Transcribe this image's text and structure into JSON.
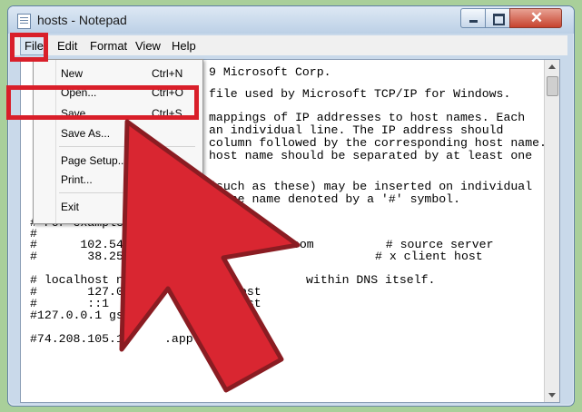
{
  "window": {
    "title": "hosts - Notepad"
  },
  "menubar": {
    "file": "File",
    "edit": "Edit",
    "format": "Format",
    "view": "View",
    "help": "Help"
  },
  "file_menu": {
    "new": {
      "label": "New",
      "shortcut": "Ctrl+N"
    },
    "open": {
      "label": "Open...",
      "shortcut": "Ctrl+O"
    },
    "save": {
      "label": "Save",
      "shortcut": "Ctrl+S"
    },
    "save_as": {
      "label": "Save As..."
    },
    "page_setup": {
      "label": "Page Setup..."
    },
    "print": {
      "label": "Print..."
    },
    "exit": {
      "label": "Exit"
    }
  },
  "editor": {
    "lines": [
      "9 Microsoft Corp.",
      "file used by Microsoft TCP/IP for Windows.",
      "mappings of IP addresses to host names. Each",
      "an individual line. The IP address should",
      "column followed by the corresponding host name.",
      "host name should be separated by at least one",
      "(such as these) may be inserted on individual",
      "chine name denoted by a '#' symbol.",
      "# For example:",
      "#",
      "#      102.54.",
      ".com          # source server",
      "#       38.25.",
      "# x client host",
      "# localhost na",
      "within DNS itself.",
      "#       127.0.",
      "host",
      "#       ::1",
      "host",
      "#127.0.0.1 gs.",
      "com",
      "#74.208.105.17",
      ".apple."
    ]
  },
  "colors": {
    "highlight": "#d91f2a",
    "arrow_fill": "#d92631",
    "arrow_stroke": "#8a1c22",
    "background": "#a9cf9a"
  },
  "icons": {
    "app": "notepad-icon",
    "pointer": "pointer-arrow-icon"
  }
}
